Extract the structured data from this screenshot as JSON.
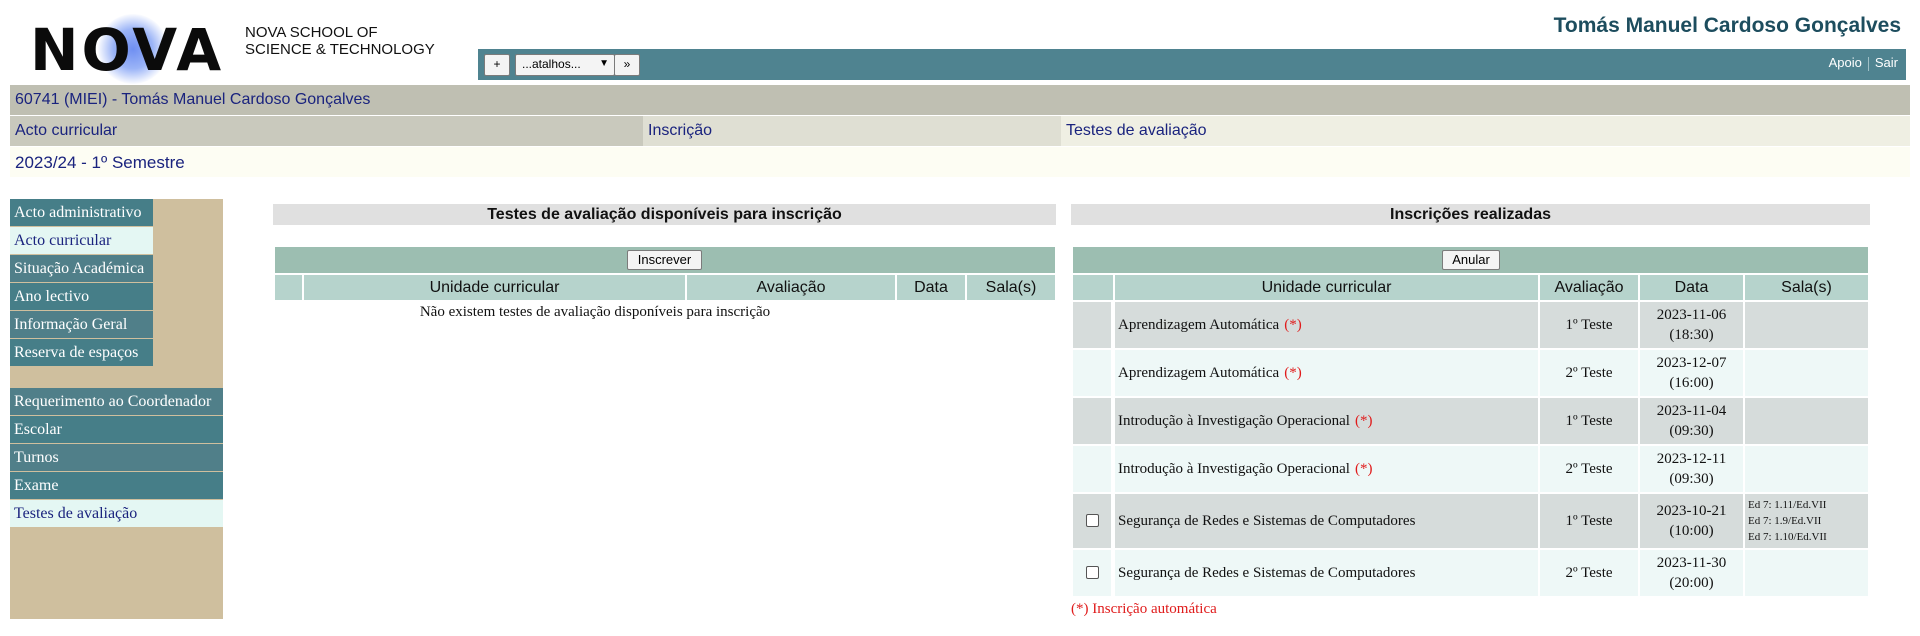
{
  "header": {
    "logo_text": "NOVA",
    "school_line1": "NOVA SCHOOL OF",
    "school_line2": "SCIENCE & TECHNOLOGY",
    "user_name": "Tomás Manuel Cardoso Gonçalves"
  },
  "toolbar": {
    "plus_label": "+",
    "shortcut_select": "...atalhos...",
    "next_label": "»",
    "help_label": "Apoio",
    "logout_label": "Sair"
  },
  "student": {
    "label": "60741 (MIEI) - Tomás Manuel Cardoso Gonçalves"
  },
  "breadcrumb": {
    "acto": "Acto curricular",
    "inscricao": "Inscrição",
    "testes": "Testes de avaliação"
  },
  "semester": "2023/24 - 1º Semestre",
  "sidebar": {
    "items": [
      {
        "label": "Acto administrativo"
      },
      {
        "label": "Acto curricular"
      },
      {
        "label": "Situação Académica"
      },
      {
        "label": "Ano lectivo"
      },
      {
        "label": "Informação Geral"
      },
      {
        "label": "Reserva de espaços"
      },
      {
        "label": "Requerimento ao Coordenador"
      },
      {
        "label": "Escolar"
      },
      {
        "label": "Turnos"
      },
      {
        "label": "Exame"
      },
      {
        "label": "Testes de avaliação"
      }
    ]
  },
  "available": {
    "title": "Testes de avaliação disponíveis para inscrição",
    "action_label": "Inscrever",
    "columns": [
      "Unidade curricular",
      "Avaliação",
      "Data",
      "Sala(s)"
    ],
    "empty_message": "Não existem testes de avaliação disponíveis para inscrição"
  },
  "done": {
    "title": "Inscrições realizadas",
    "action_label": "Anular",
    "columns": [
      "Unidade curricular",
      "Avaliação",
      "Data",
      "Sala(s)"
    ],
    "auto_mark": "(*)",
    "rows": [
      {
        "course": "Aprendizagem Automática",
        "auto": true,
        "eval": "1º Teste",
        "date": "2023-11-06",
        "time": "(18:30)",
        "rooms": []
      },
      {
        "course": "Aprendizagem Automática",
        "auto": true,
        "eval": "2º Teste",
        "date": "2023-12-07",
        "time": "(16:00)",
        "rooms": []
      },
      {
        "course": "Introdução à Investigação Operacional",
        "auto": true,
        "eval": "1º Teste",
        "date": "2023-11-04",
        "time": "(09:30)",
        "rooms": []
      },
      {
        "course": "Introdução à Investigação Operacional",
        "auto": true,
        "eval": "2º Teste",
        "date": "2023-12-11",
        "time": "(09:30)",
        "rooms": []
      },
      {
        "course": "Segurança de Redes e Sistemas de Computadores",
        "auto": false,
        "eval": "1º Teste",
        "date": "2023-10-21",
        "time": "(10:00)",
        "rooms": [
          "Ed 7: 1.11/Ed.VII",
          "Ed 7: 1.9/Ed.VII",
          "Ed 7: 1.10/Ed.VII"
        ]
      },
      {
        "course": "Segurança de Redes e Sistemas de Computadores",
        "auto": false,
        "eval": "2º Teste",
        "date": "2023-11-30",
        "time": "(20:00)",
        "rooms": []
      }
    ],
    "legend": "(*) Inscrição automática"
  },
  "colors": {
    "toolbar": "#4f8390",
    "sidebar_bg": "#cfbf9e",
    "sidebar_item": "#467e88",
    "sidebar_active": "#e4f7f3",
    "auto_mark": "#e01b1b",
    "link_text": "#1a237e"
  }
}
